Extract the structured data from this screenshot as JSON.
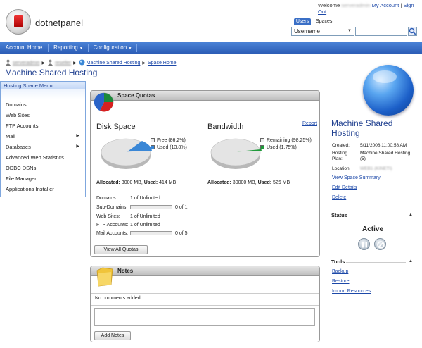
{
  "header": {
    "app_name": "dotnetpanel",
    "welcome_prefix": "Welcome",
    "username_blurred": "serveradmin",
    "my_account": "My Account",
    "sign_out": "Sign Out",
    "separator": "|",
    "search_tabs": [
      "Users",
      "Spaces"
    ],
    "search_field_selected": "Username",
    "search_input_value": ""
  },
  "nav": {
    "items": [
      "Account Home",
      "Reporting",
      "Configuration"
    ]
  },
  "breadcrumb": {
    "user1_blurred": "serveradmin",
    "user2_blurred": "reseller",
    "space": "Machine Shared Hosting",
    "home": "Space Home"
  },
  "page": {
    "title": "Machine Shared Hosting"
  },
  "menu": {
    "header": "Hosting Space Menu",
    "items": [
      {
        "label": "Domains",
        "sub": false
      },
      {
        "label": "Web Sites",
        "sub": false
      },
      {
        "label": "FTP Accounts",
        "sub": false
      },
      {
        "label": "Mail",
        "sub": true
      },
      {
        "label": "Databases",
        "sub": true
      },
      {
        "label": "Advanced Web Statistics",
        "sub": false
      },
      {
        "label": "ODBC DSNs",
        "sub": false
      },
      {
        "label": "File Manager",
        "sub": false
      },
      {
        "label": "Applications Installer",
        "sub": false
      }
    ]
  },
  "quotas": {
    "title": "Space Quotas",
    "disk": {
      "title": "Disk Space",
      "free_label": "Free (86.2%)",
      "used_label": "Used (13.8%)",
      "used_fraction": 0.138,
      "allocated_label": "Allocated:",
      "allocated": "3000 MB,",
      "used_word": "Used:",
      "used": "414 MB"
    },
    "bandwidth": {
      "title": "Bandwidth",
      "report_link": "Report",
      "remaining_label": "Remaining (98.25%)",
      "used_label": "Used (1.75%)",
      "used_fraction": 0.0175,
      "allocated_label": "Allocated:",
      "allocated": "30000 MB,",
      "used_word": "Used:",
      "used": "526 MB"
    },
    "rows": [
      {
        "label": "Domains:",
        "value": "1 of Unlimited",
        "bar": false
      },
      {
        "label": "Sub-Domains:",
        "value": "0 of 1",
        "bar": true
      },
      {
        "label": "Web Sites:",
        "value": "1 of Unlimited",
        "bar": false
      },
      {
        "label": "FTP Accounts:",
        "value": "1 of Unlimited",
        "bar": false
      },
      {
        "label": "Mail Accounts:",
        "value": "0 of 5",
        "bar": true
      }
    ],
    "view_all_button": "View All Quotas"
  },
  "notes": {
    "title": "Notes",
    "empty_text": "No comments added",
    "add_button": "Add Notes"
  },
  "space_info": {
    "name": "Machine Shared Hosting",
    "created_label": "Created:",
    "created": "5/11/2008 11:00:58 AM",
    "plan_label": "Hosting Plan:",
    "plan": "Machine Shared Hosting (5)",
    "location_label": "Location:",
    "location_blurred": "WEB1 (KINETI)",
    "links": [
      "View Space Summary",
      "Edit Details",
      "Delete"
    ]
  },
  "status": {
    "title": "Status",
    "value": "Active"
  },
  "tools": {
    "title": "Tools",
    "links": [
      "Backup",
      "Restore",
      "Import Resources"
    ]
  },
  "colors": {
    "nav_blue": "#2c5db6",
    "title_blue": "#1f3f8f",
    "link_blue": "#1c48a8",
    "pie_used": "#3a87d6",
    "bw_used": "#1f9a3a"
  }
}
